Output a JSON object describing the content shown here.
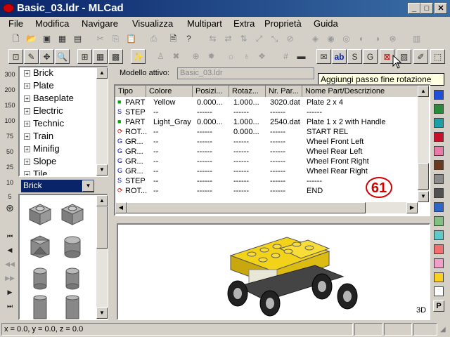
{
  "window": {
    "title": "Basic_03.ldr - MLCad"
  },
  "menu": [
    "File",
    "Modifica",
    "Navigare",
    "Visualizza",
    "Multipart",
    "Extra",
    "Proprietà",
    "Guida"
  ],
  "tree": {
    "items": [
      "Brick",
      "Plate",
      "Baseplate",
      "Electric",
      "Technic",
      "Train",
      "Minifig",
      "Slope",
      "Tile"
    ],
    "selected": "Brick"
  },
  "parts_combo": {
    "value": "Brick"
  },
  "zoom_labels": [
    "300",
    "200",
    "150",
    "100",
    "75",
    "50",
    "25",
    "10",
    "5"
  ],
  "model": {
    "label": "Modello attivo:",
    "value": "Basic_03.ldr"
  },
  "table": {
    "headers": [
      "Tipo",
      "Colore",
      "Posizi...",
      "Rotaz...",
      "Nr. Par...",
      "Nome Part/Descrizione"
    ],
    "rows": [
      {
        "type": "PART",
        "color": "Yellow",
        "pos": "0.000...",
        "rot": "1.000...",
        "nr": "3020.dat",
        "name": "Plate  2 x  4"
      },
      {
        "type": "STEP",
        "color": "--",
        "pos": "------",
        "rot": "------",
        "nr": "------",
        "name": "------"
      },
      {
        "type": "PART",
        "color": "Light_Gray",
        "pos": "0.000...",
        "rot": "1.000...",
        "nr": "2540.dat",
        "name": "Plate  1 x  2 with Handle"
      },
      {
        "type": "ROT...",
        "color": "--",
        "pos": "------",
        "rot": "0.000...",
        "nr": "------",
        "name": "START REL"
      },
      {
        "type": "GR...",
        "color": "--",
        "pos": "------",
        "rot": "------",
        "nr": "------",
        "name": "Wheel Front Left"
      },
      {
        "type": "GR...",
        "color": "--",
        "pos": "------",
        "rot": "------",
        "nr": "------",
        "name": "Wheel Rear Left"
      },
      {
        "type": "GR...",
        "color": "--",
        "pos": "------",
        "rot": "------",
        "nr": "------",
        "name": "Wheel Front Right"
      },
      {
        "type": "GR...",
        "color": "--",
        "pos": "------",
        "rot": "------",
        "nr": "------",
        "name": "Wheel Rear Right"
      },
      {
        "type": "STEP",
        "color": "--",
        "pos": "------",
        "rot": "------",
        "nr": "------",
        "name": "------"
      },
      {
        "type": "ROT...",
        "color": "--",
        "pos": "------",
        "rot": "------",
        "nr": "------",
        "name": "END"
      }
    ]
  },
  "annotation": "61",
  "tooltip": "Aggiungi passo fine rotazione",
  "view": {
    "label": "3D"
  },
  "palette_key": "P",
  "status": {
    "coords": "x = 0.0, y = 0.0, z = 0.0"
  },
  "colors": {
    "title_start": "#0a246a",
    "title_end": "#3a6ea5",
    "annotation": "#d40000",
    "tooltip_bg": "#ffffe1"
  },
  "palette": [
    "#1f4fd8",
    "#2a8a3a",
    "#1aa0a8",
    "#c8102e",
    "#e87aa8",
    "#6b3a1e",
    "#8a8a8a",
    "#505050",
    "#2f64c8",
    "#80c080",
    "#60c8c8",
    "#f07070",
    "#f0a0c8",
    "#f8d020",
    "#ffffff"
  ]
}
